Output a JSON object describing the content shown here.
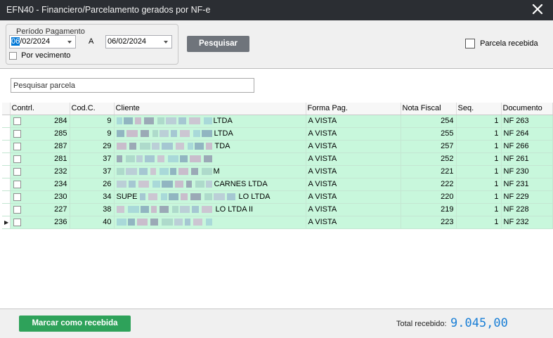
{
  "window": {
    "title": "EFN40 - Financiero/Parcelamento gerados por NF-e"
  },
  "filters": {
    "group_label": "Período Pagamento",
    "date_from_selected": "06",
    "date_from_rest": "/02/2024",
    "range_separator": "A",
    "date_to": "06/02/2024",
    "por_vencimento_label": "Por vecimento",
    "search_button": "Pesquisar",
    "parcela_recebida_label": "Parcela recebida"
  },
  "search": {
    "placeholder": "Pesquisar parcela"
  },
  "table": {
    "headers": {
      "contrl": "Contrl.",
      "codc": "Cod.C.",
      "cliente": "Cliente",
      "forma": "Forma Pag.",
      "nota": "Nota Fiscal",
      "seq": "Seq.",
      "documento": "Documento"
    },
    "rows": [
      {
        "contrl": "284",
        "codc": "9",
        "cliente": "LTDA",
        "forma": "A VISTA",
        "nota": "254",
        "seq": "1",
        "documento": "NF 263"
      },
      {
        "contrl": "285",
        "codc": "9",
        "cliente": "LTDA",
        "forma": "A VISTA",
        "nota": "255",
        "seq": "1",
        "documento": "NF 264"
      },
      {
        "contrl": "287",
        "codc": "29",
        "cliente": "TDA",
        "forma": "A VISTA",
        "nota": "257",
        "seq": "1",
        "documento": "NF 266"
      },
      {
        "contrl": "281",
        "codc": "37",
        "cliente": "",
        "forma": "A VISTA",
        "nota": "252",
        "seq": "1",
        "documento": "NF 261"
      },
      {
        "contrl": "232",
        "codc": "37",
        "cliente": "M",
        "forma": "A VISTA",
        "nota": "221",
        "seq": "1",
        "documento": "NF 230"
      },
      {
        "contrl": "234",
        "codc": "26",
        "cliente": "CARNES LTDA",
        "forma": "A VISTA",
        "nota": "222",
        "seq": "1",
        "documento": "NF 231"
      },
      {
        "contrl": "230",
        "codc": "34",
        "cliente": "SUPE",
        "cliente_suffix": "LO LTDA",
        "forma": "A VISTA",
        "nota": "220",
        "seq": "1",
        "documento": "NF 229"
      },
      {
        "contrl": "227",
        "codc": "38",
        "cliente": "",
        "cliente_suffix": "LO LTDA II",
        "forma": "A VISTA",
        "nota": "219",
        "seq": "1",
        "documento": "NF 228"
      },
      {
        "contrl": "236",
        "codc": "40",
        "cliente": "",
        "forma": "A VISTA",
        "nota": "223",
        "seq": "1",
        "documento": "NF 232",
        "current": true
      }
    ]
  },
  "footer": {
    "mark_button": "Marcar como recebida",
    "total_label": "Total recebido:",
    "total_value": "9.045,00"
  },
  "colors": {
    "titlebar": "#2b2e33",
    "row_green": "#c8f7dc",
    "mark_button": "#2ea25a",
    "search_button": "#6f747b",
    "total_value": "#1a7fd6"
  }
}
